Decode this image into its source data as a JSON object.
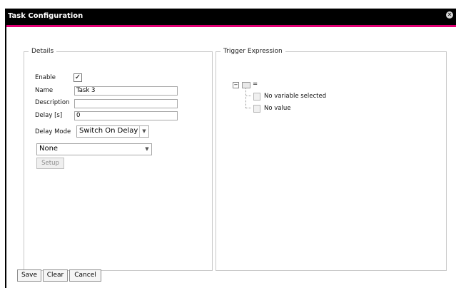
{
  "window": {
    "title": "Task Configuration"
  },
  "details": {
    "legend": "Details",
    "enable_label": "Enable",
    "enable_checked": true,
    "name_label": "Name",
    "name_value": "Task 3",
    "description_label": "Description",
    "description_value": "",
    "delay_label": "Delay [s]",
    "delay_value": "0",
    "delay_mode_label": "Delay Mode",
    "delay_mode_value": "Switch On Delay",
    "none_value": "None",
    "setup_label": "Setup"
  },
  "trigger": {
    "legend": "Trigger Expression",
    "root_operator": "=",
    "children": [
      "No variable selected",
      "No value"
    ]
  },
  "footer": {
    "save_label": "Save",
    "clear_label": "Clear",
    "cancel_label": "Cancel"
  },
  "colors": {
    "accent": "#e20074",
    "titlebar": "#000000"
  },
  "icons": [
    "close-icon",
    "checkmark-icon",
    "chevron-down-icon",
    "collapse-icon",
    "folder-icon",
    "document-icon"
  ]
}
